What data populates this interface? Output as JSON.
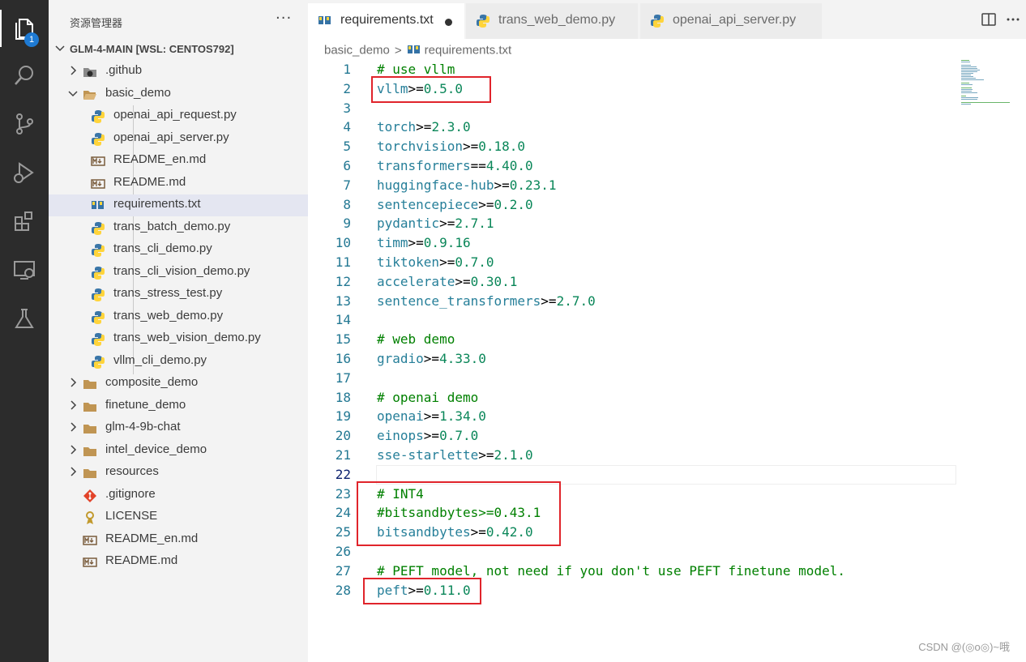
{
  "activity_bar": {
    "items": [
      {
        "name": "explorer-icon",
        "active": true
      },
      {
        "name": "search-icon"
      },
      {
        "name": "source-control-icon"
      },
      {
        "name": "run-debug-icon"
      },
      {
        "name": "extensions-icon"
      },
      {
        "name": "remote-explorer-icon"
      },
      {
        "name": "testing-icon"
      }
    ],
    "explorer_badge": "1"
  },
  "sidebar": {
    "title": "资源管理器",
    "more": "···",
    "root": "GLM-4-MAIN [WSL: CENTOS792]",
    "items": [
      {
        "label": ".github",
        "type": "folder-github"
      },
      {
        "label": "basic_demo",
        "type": "folder-open"
      },
      {
        "label": "openai_api_request.py",
        "type": "python"
      },
      {
        "label": "openai_api_server.py",
        "type": "python"
      },
      {
        "label": "README_en.md",
        "type": "markdown"
      },
      {
        "label": "README.md",
        "type": "markdown"
      },
      {
        "label": "requirements.txt",
        "type": "pip"
      },
      {
        "label": "trans_batch_demo.py",
        "type": "python"
      },
      {
        "label": "trans_cli_demo.py",
        "type": "python"
      },
      {
        "label": "trans_cli_vision_demo.py",
        "type": "python"
      },
      {
        "label": "trans_stress_test.py",
        "type": "python"
      },
      {
        "label": "trans_web_demo.py",
        "type": "python"
      },
      {
        "label": "trans_web_vision_demo.py",
        "type": "python"
      },
      {
        "label": "vllm_cli_demo.py",
        "type": "python"
      },
      {
        "label": "composite_demo",
        "type": "folder"
      },
      {
        "label": "finetune_demo",
        "type": "folder"
      },
      {
        "label": "glm-4-9b-chat",
        "type": "folder"
      },
      {
        "label": "intel_device_demo",
        "type": "folder"
      },
      {
        "label": "resources",
        "type": "folder"
      },
      {
        "label": ".gitignore",
        "type": "git"
      },
      {
        "label": "LICENSE",
        "type": "license"
      },
      {
        "label": "README_en.md",
        "type": "markdown"
      },
      {
        "label": "README.md",
        "type": "markdown"
      }
    ]
  },
  "tabs": [
    {
      "label": "requirements.txt",
      "active": true,
      "modified": true
    },
    {
      "label": "trans_web_demo.py",
      "active": false
    },
    {
      "label": "openai_api_server.py",
      "active": false
    }
  ],
  "breadcrumb": {
    "folder": "basic_demo",
    "separator": ">",
    "file": "requirements.txt"
  },
  "editor": {
    "lines": [
      {
        "n": "1",
        "comment": "# use vllm"
      },
      {
        "n": "2",
        "pkg": "vllm",
        "op": ">=",
        "ver": "0.5.0"
      },
      {
        "n": "3"
      },
      {
        "n": "4",
        "pkg": "torch",
        "op": ">=",
        "ver": "2.3.0"
      },
      {
        "n": "5",
        "pkg": "torchvision",
        "op": ">=",
        "ver": "0.18.0"
      },
      {
        "n": "6",
        "pkg": "transformers",
        "op": "==",
        "ver": "4.40.0"
      },
      {
        "n": "7",
        "pkg": "huggingface-hub",
        "op": ">=",
        "ver": "0.23.1"
      },
      {
        "n": "8",
        "pkg": "sentencepiece",
        "op": ">=",
        "ver": "0.2.0"
      },
      {
        "n": "9",
        "pkg": "pydantic",
        "op": ">=",
        "ver": "2.7.1"
      },
      {
        "n": "10",
        "pkg": "timm",
        "op": ">=",
        "ver": "0.9.16"
      },
      {
        "n": "11",
        "pkg": "tiktoken",
        "op": ">=",
        "ver": "0.7.0"
      },
      {
        "n": "12",
        "pkg": "accelerate",
        "op": ">=",
        "ver": "0.30.1"
      },
      {
        "n": "13",
        "pkg": "sentence_transformers",
        "op": ">=",
        "ver": "2.7.0"
      },
      {
        "n": "14"
      },
      {
        "n": "15",
        "comment": "# web demo"
      },
      {
        "n": "16",
        "pkg": "gradio",
        "op": ">=",
        "ver": "4.33.0"
      },
      {
        "n": "17"
      },
      {
        "n": "18",
        "comment": "# openai demo"
      },
      {
        "n": "19",
        "pkg": "openai",
        "op": ">=",
        "ver": "1.34.0"
      },
      {
        "n": "20",
        "pkg": "einops",
        "op": ">=",
        "ver": "0.7.0"
      },
      {
        "n": "21",
        "pkg": "sse-starlette",
        "op": ">=",
        "ver": "2.1.0"
      },
      {
        "n": "22",
        "current": true
      },
      {
        "n": "23",
        "comment": "# INT4"
      },
      {
        "n": "24",
        "pkg": "#bitsandbytes",
        "op": ">=",
        "ver": "0.43.1"
      },
      {
        "n": "25",
        "pkg": "bitsandbytes",
        "op": ">=",
        "ver": "0.42.0"
      },
      {
        "n": "26"
      },
      {
        "n": "27",
        "comment": "# PEFT model, not need if you don't use PEFT finetune model."
      },
      {
        "n": "28",
        "pkg": "peft",
        "op": ">=",
        "ver": "0.11.0"
      }
    ]
  },
  "annotations": {
    "color": "#e0242b"
  },
  "watermark": "CSDN @(◎o◎)~哦"
}
